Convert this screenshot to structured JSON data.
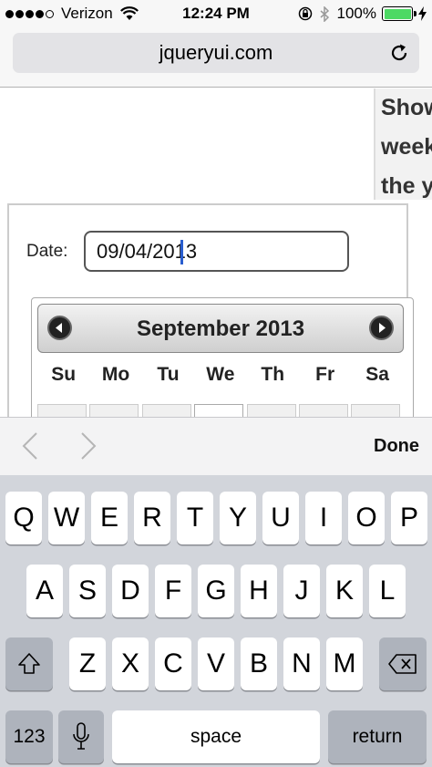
{
  "status_bar": {
    "carrier": "Verizon",
    "time": "12:24 PM",
    "battery": "100%",
    "signal_bars": 4,
    "battery_level": 1.0,
    "battery_color": "#4cd964"
  },
  "browser": {
    "url": "jqueryui.com",
    "reload_icon": "reload-icon"
  },
  "page": {
    "side_text": [
      "Show",
      "week",
      "the y"
    ],
    "date_label": "Date:",
    "date_value": "09/04/2013",
    "datepicker": {
      "title": "September 2013",
      "weekdays": [
        "Su",
        "Mo",
        "Tu",
        "We",
        "Th",
        "Fr",
        "Sa"
      ]
    }
  },
  "accessory_bar": {
    "prev_icon": "chevron-left-icon",
    "next_icon": "chevron-right-icon",
    "done_label": "Done"
  },
  "keyboard": {
    "row1": [
      "Q",
      "W",
      "E",
      "R",
      "T",
      "Y",
      "U",
      "I",
      "O",
      "P"
    ],
    "row2": [
      "A",
      "S",
      "D",
      "F",
      "G",
      "H",
      "J",
      "K",
      "L"
    ],
    "row3": [
      "Z",
      "X",
      "C",
      "V",
      "B",
      "N",
      "M"
    ],
    "numbers_label": "123",
    "space_label": "space",
    "return_label": "return",
    "shift_icon": "shift-icon",
    "mic_icon": "microphone-icon",
    "delete_icon": "backspace-icon"
  }
}
